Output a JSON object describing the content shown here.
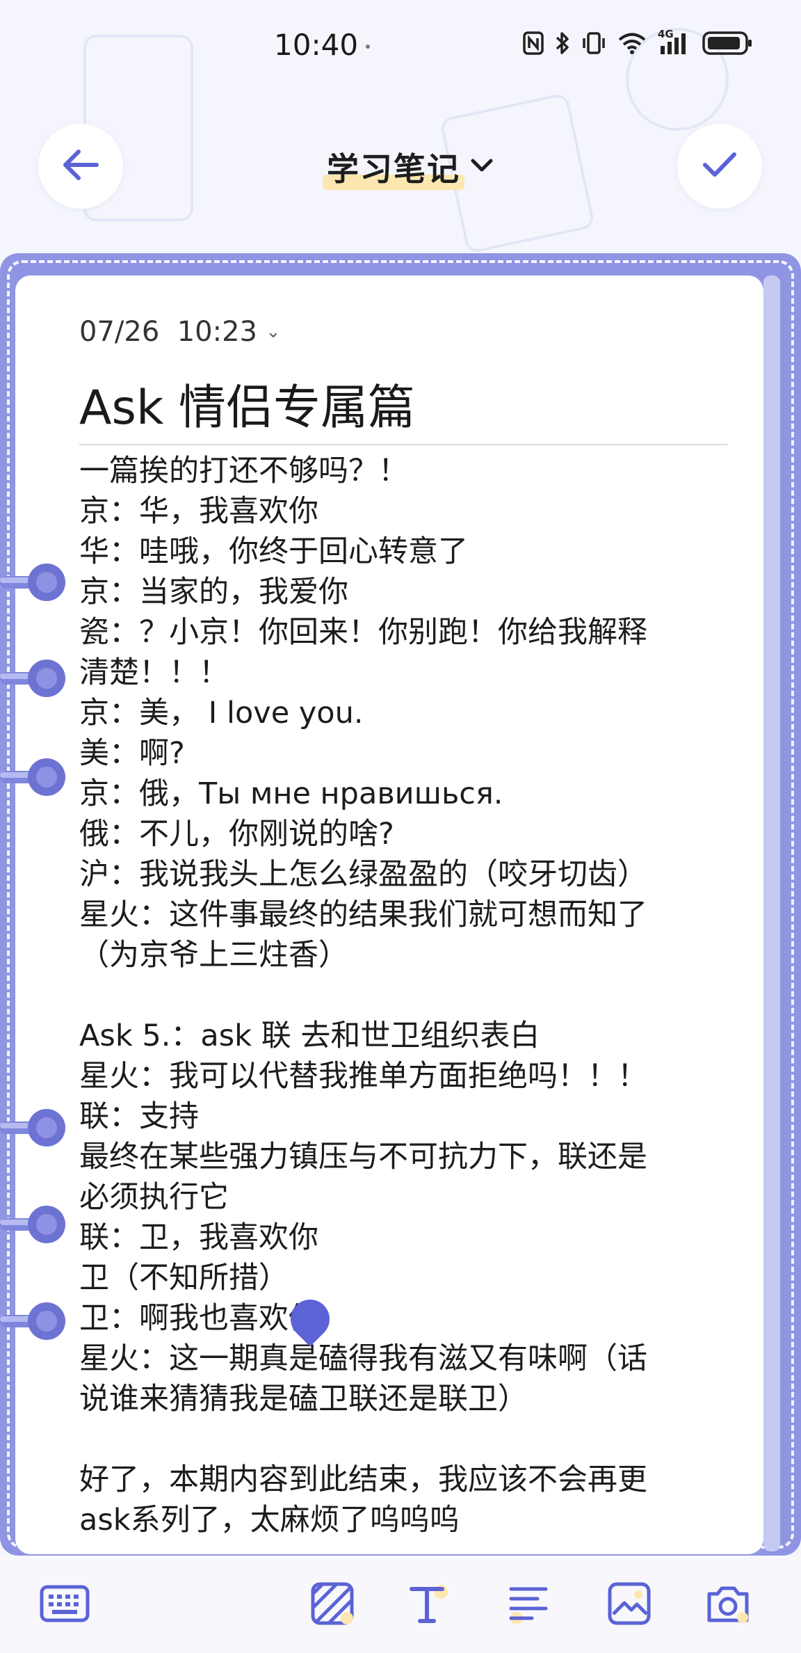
{
  "status_bar": {
    "time": "10:40",
    "icons": [
      "nfc-icon",
      "bluetooth-icon",
      "vibrate-icon",
      "wifi-icon",
      "signal-4g-icon",
      "battery-icon"
    ],
    "network_label": "4G"
  },
  "header": {
    "folder_title": "学习笔记",
    "back_icon": "arrow-left-icon",
    "done_icon": "check-icon",
    "dropdown_icon": "chevron-down-icon"
  },
  "note": {
    "date": "07/26  10:23",
    "date_caret": "⌄",
    "title": "Ask 情侣专属篇",
    "lines": [
      "一篇挨的打还不够吗？！",
      "京：华，我喜欢你",
      "华：哇哦，你终于回心转意了",
      "京：当家的，我爱你",
      "瓷：？小京！你回来！你别跑！你给我解释",
      "清楚！！！",
      "京：美， I love you.",
      "美：啊?",
      "京：俄，Ты мне нравишься.",
      "俄：不儿，你刚说的啥?",
      "沪：我说我头上怎么绿盈盈的（咬牙切齿）",
      "星火：这件事最终的结果我们就可想而知了",
      "（为京爷上三炷香）",
      "",
      "Ask 5.：ask 联 去和世卫组织表白",
      "星火：我可以代替我推单方面拒绝吗！！！",
      "联：支持",
      "最终在某些强力镇压与不可抗力下，联还是",
      "必须执行它",
      "联：卫，我喜欢你",
      "卫（不知所措）",
      "卫：啊我也喜欢你",
      "星火：这一期真是磕得我有滋又有味啊（话",
      "说谁来猜猜我是磕卫联还是联卫）",
      "",
      "好了，本期内容到此结束，我应该不会再更",
      "ask系列了，太麻烦了呜呜呜"
    ]
  },
  "toolbar": {
    "items": [
      "keyboard-icon",
      "style-pattern-icon",
      "text-format-icon",
      "list-format-icon",
      "image-icon",
      "camera-icon"
    ]
  },
  "colors": {
    "frame": "#8f95e2",
    "accent": "#5b63d6",
    "highlight": "#fde7b0",
    "background": "#f5f6fd"
  }
}
